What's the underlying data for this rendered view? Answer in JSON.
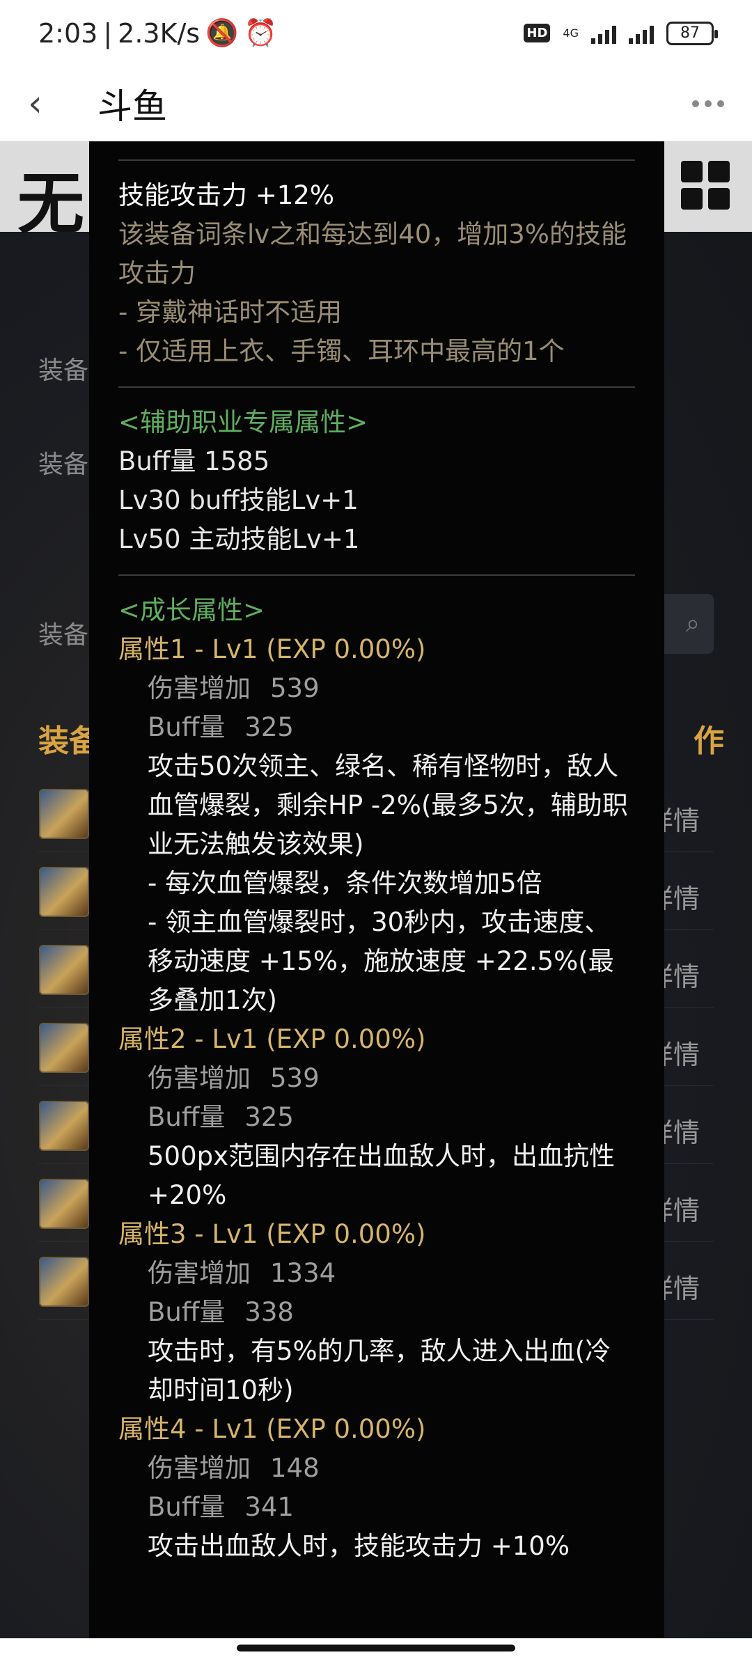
{
  "status": {
    "time": "2:03",
    "speed": "2.3K/s",
    "hd": "HD",
    "network": "4G",
    "battery": "87"
  },
  "appbar": {
    "back": "‹",
    "title": "斗鱼"
  },
  "background": {
    "logo": "无",
    "labels": [
      "装备",
      "装备",
      "装备"
    ],
    "section_left": "装备",
    "section_right": "作",
    "detail": "详情"
  },
  "tooltip": {
    "skill_attack": {
      "title": "技能攻击力 +12%",
      "desc": "该装备词条lv之和每达到40，增加3%的技能攻击力",
      "note1": "- 穿戴神话时不适用",
      "note2": "- 仅适用上衣、手镯、耳环中最高的1个"
    },
    "support": {
      "header": "<辅助职业专属属性>",
      "buff": "Buff量   1585",
      "lv30": "Lv30 buff技能Lv+1",
      "lv50": "Lv50 主动技能Lv+1"
    },
    "growth": {
      "header": "<成长属性>",
      "attrs": [
        {
          "title": "属性1 - Lv1 (EXP 0.00%)",
          "dmg_label": "伤害增加",
          "dmg": "539",
          "buff_label": "Buff量",
          "buff": "325",
          "effect": "攻击50次领主、绿名、稀有怪物时，敌人血管爆裂，剩余HP -2%(最多5次，辅助职业无法触发该效果)",
          "effect2": "- 每次血管爆裂，条件次数增加5倍",
          "effect3": "- 领主血管爆裂时，30秒内，攻击速度、移动速度 +15%，施放速度 +22.5%(最多叠加1次)"
        },
        {
          "title": "属性2 - Lv1 (EXP 0.00%)",
          "dmg_label": "伤害增加",
          "dmg": "539",
          "buff_label": "Buff量",
          "buff": "325",
          "effect": "500px范围内存在出血敌人时，出血抗性 +20%"
        },
        {
          "title": "属性3 - Lv1 (EXP 0.00%)",
          "dmg_label": "伤害增加",
          "dmg": "1334",
          "buff_label": "Buff量",
          "buff": "338",
          "effect": "攻击时，有5%的几率，敌人进入出血(冷却时间10秒)"
        },
        {
          "title": "属性4 - Lv1 (EXP 0.00%)",
          "dmg_label": "伤害增加",
          "dmg": "148",
          "buff_label": "Buff量",
          "buff": "341",
          "effect": "攻击出血敌人时，技能攻击力 +10%"
        }
      ]
    }
  },
  "colors": {
    "green": "#5fae5f",
    "gold": "#d6b46a",
    "desc": "#9a8d74",
    "panel": "#050505"
  }
}
